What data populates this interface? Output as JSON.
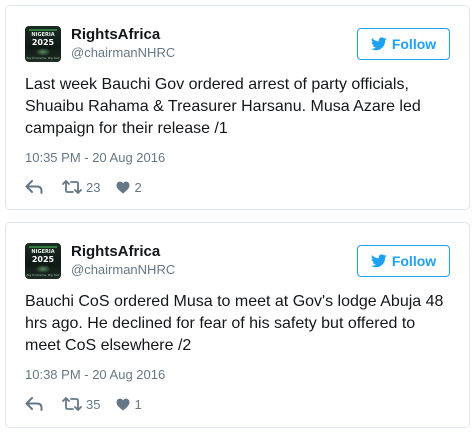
{
  "tweets": [
    {
      "name": "RightsAfrica",
      "handle": "@chairmanNHRC",
      "follow_label": "Follow",
      "avatar": {
        "line1": "NIGERIA",
        "line2": "2025",
        "line3": "Big Problems, Big Talk"
      },
      "text": "Last week Bauchi Gov ordered arrest of party officials, Shuaibu Rahama & Treasurer Harsanu. Musa Azare led campaign for their release /1",
      "time": "10:35 PM - 20 Aug 2016",
      "retweets": "23",
      "likes": "2"
    },
    {
      "name": "RightsAfrica",
      "handle": "@chairmanNHRC",
      "follow_label": "Follow",
      "avatar": {
        "line1": "NIGERIA",
        "line2": "2025",
        "line3": "Big Problems, Big Talk"
      },
      "text": "Bauchi CoS ordered Musa to meet at Gov's lodge Abuja 48 hrs ago. He declined for fear of his safety but offered to meet CoS elsewhere /2",
      "time": "10:38 PM - 20 Aug 2016",
      "retweets": "35",
      "likes": "1"
    }
  ],
  "icons": {
    "follow": "twitter-bird-icon",
    "reply": "reply-icon",
    "retweet": "retweet-icon",
    "like": "heart-icon"
  },
  "colors": {
    "accent": "#1da1f2",
    "text": "#14171a",
    "muted": "#657786",
    "border": "#e1e8ed"
  }
}
